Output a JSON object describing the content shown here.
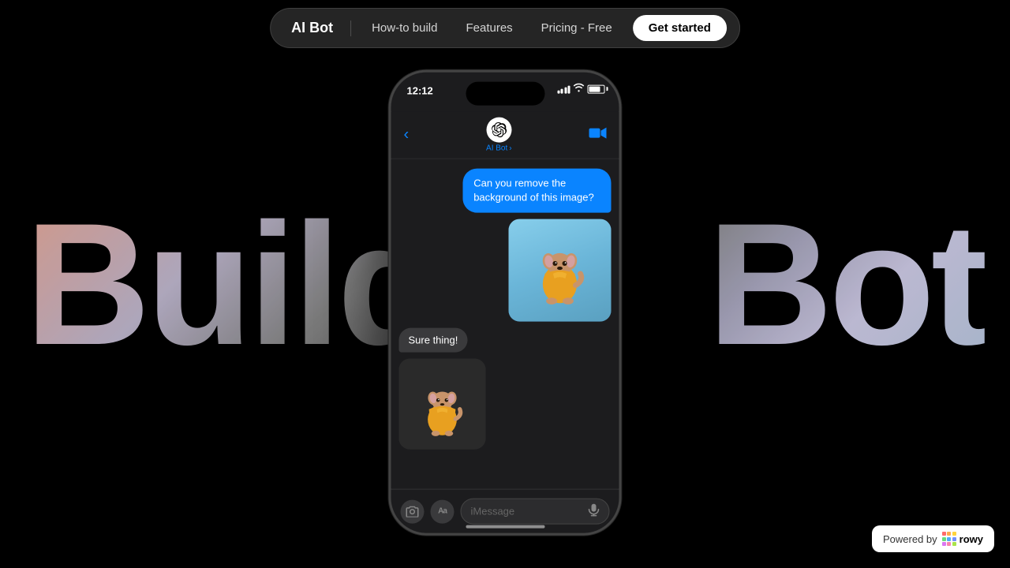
{
  "background": "#000000",
  "bg_text": {
    "build": "Build",
    "bot": "Bot"
  },
  "navbar": {
    "logo": "AI Bot",
    "links": [
      {
        "label": "How-to build",
        "id": "how-to-build"
      },
      {
        "label": "Features",
        "id": "features"
      },
      {
        "label": "Pricing - Free",
        "id": "pricing"
      }
    ],
    "cta": "Get started"
  },
  "phone": {
    "status_bar": {
      "time": "12:12",
      "battery_level": "80%"
    },
    "chat_header": {
      "back_label": "‹",
      "name": "AI Bot",
      "name_suffix": "›",
      "video_icon": "□"
    },
    "messages": [
      {
        "type": "outgoing-text",
        "text": "Can you remove the background of this image?"
      },
      {
        "type": "outgoing-image",
        "alt": "Dog in yellow jacket on blue background"
      },
      {
        "type": "incoming-text",
        "text": "Sure thing!"
      },
      {
        "type": "incoming-image",
        "alt": "Dog in yellow jacket, background removed"
      }
    ],
    "input_bar": {
      "camera_icon": "📷",
      "aa_icon": "AA",
      "placeholder": "iMessage",
      "mic_icon": "🎤"
    }
  },
  "powered_by": {
    "label": "Powered by",
    "brand": "rowy"
  }
}
